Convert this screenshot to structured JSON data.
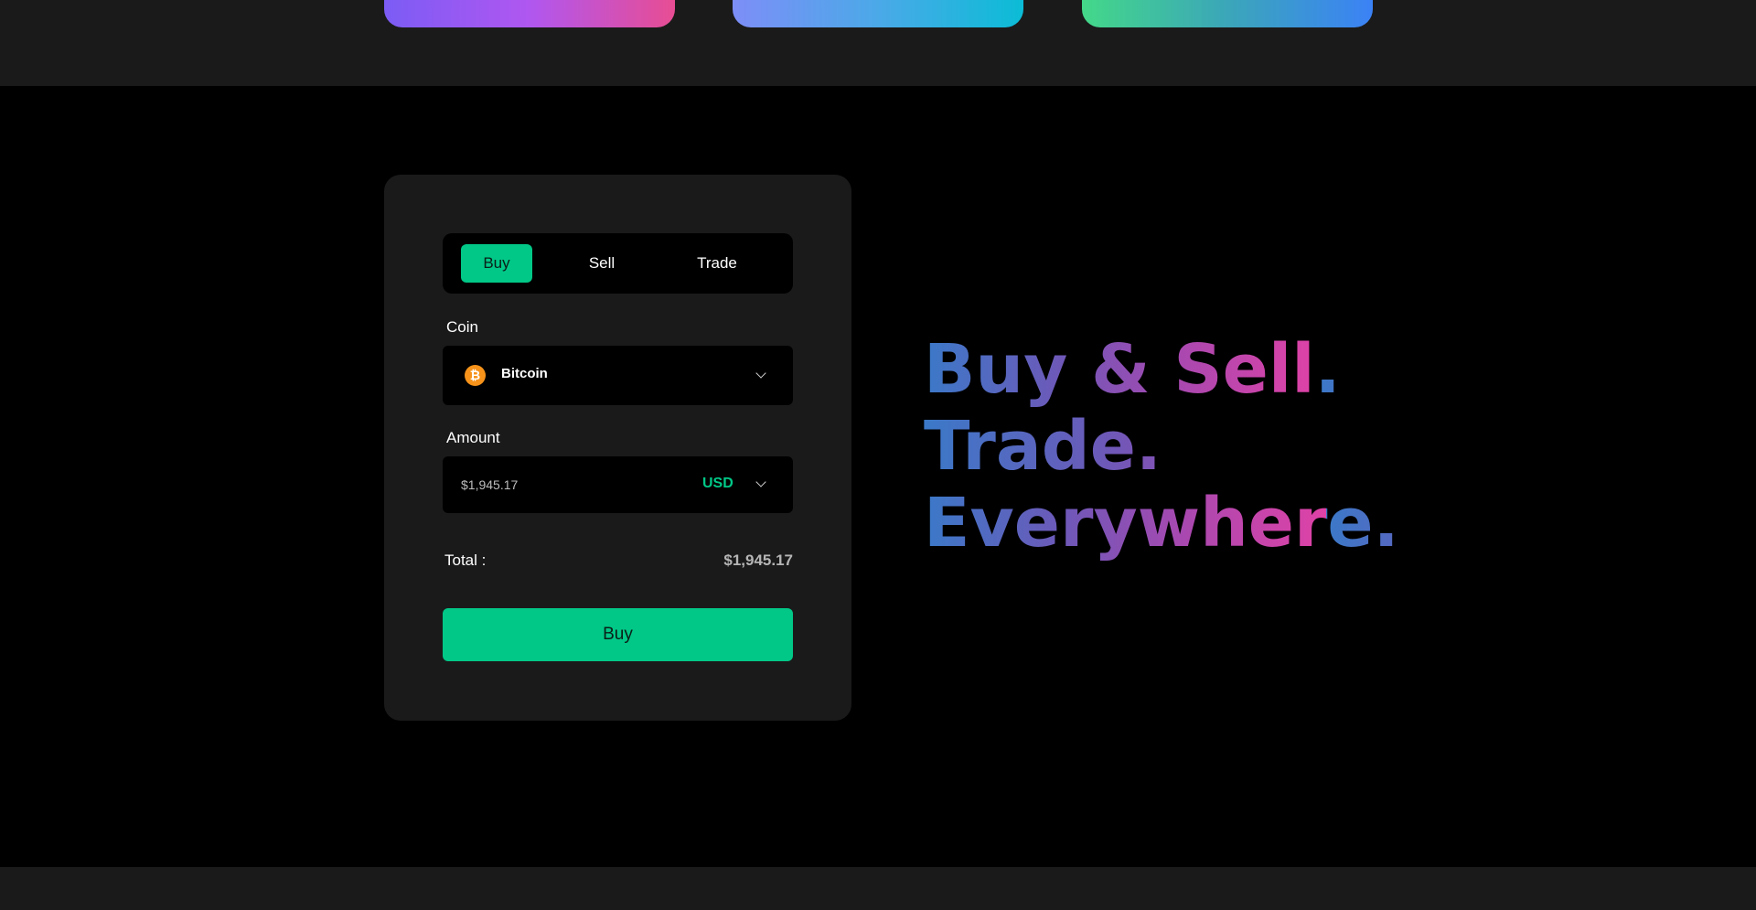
{
  "trade_widget": {
    "tabs": [
      {
        "label": "Buy",
        "active": true
      },
      {
        "label": "Sell",
        "active": false
      },
      {
        "label": "Trade",
        "active": false
      }
    ],
    "coin": {
      "label": "Coin",
      "selected": "Bitcoin",
      "icon": "bitcoin-icon",
      "icon_glyph": "₿",
      "icon_color": "#f7931a"
    },
    "amount": {
      "label": "Amount",
      "value": "$1,945.17",
      "currency": "USD"
    },
    "total": {
      "label": "Total :",
      "value": "$1,945.17"
    },
    "submit_label": "Buy"
  },
  "headline": {
    "lines": [
      "Buy & Sell.",
      "Trade.",
      "Everywhere."
    ]
  },
  "colors": {
    "accent": "#01c887",
    "panel": "#1a1a1a",
    "background": "#000000"
  }
}
